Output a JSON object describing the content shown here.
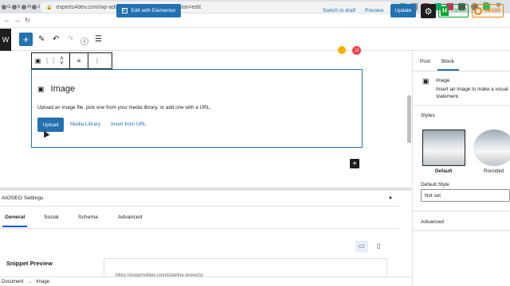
{
  "browser": {
    "tabs": [
      "G",
      "S",
      "Pi",
      "Je",
      "(1",
      "G",
      "ec",
      "G",
      "Ja",
      "",
      "W",
      "S",
      "(1",
      "(1",
      "(1",
      "W",
      "(1",
      "Pi",
      "S",
      "kt",
      "Ki",
      "G",
      "G",
      "W",
      "(1",
      "(1",
      "(1",
      "S",
      "Le",
      "G",
      "ch",
      "S",
      "Je"
    ],
    "active_tab_index": 15,
    "new_tab": "+",
    "url": "experts4dev.com/wp-admin/post.php?post=49&action=edit"
  },
  "toolbar": {
    "wp_logo": "W",
    "inserter": "+",
    "edit_elementor": "Edit with Elementor",
    "switch_draft": "Switch to draft",
    "preview": "Preview",
    "update": "Update",
    "settings": "⚙",
    "aioseo_icon": "H",
    "aioseo_score": "73/100",
    "truseo_score": "58/100"
  },
  "block_toolbar": {
    "type_icon": "image-icon",
    "drag": "⋮⋮",
    "move_up": "˄",
    "move_down": "˅",
    "align": "≡",
    "more": "⋮"
  },
  "placeholder": {
    "title": "Image",
    "instructions": "Upload an image file, pick one from your media library, or add one with a URL.",
    "upload": "Upload",
    "media_library": "Media Library",
    "insert_url": "Insert from URL"
  },
  "appender": "+",
  "notification_count": "12",
  "aioseo_panel": {
    "title": "AIOSEO Settings",
    "caret": "▲",
    "tabs": [
      "General",
      "Social",
      "Schema",
      "Advanced"
    ],
    "active_tab": 0,
    "snippet_title": "Snippet Preview",
    "snippet_url": "https://experts4dev.com/pipeline-projects/"
  },
  "statusbar": {
    "root": "Document",
    "arrow": "→",
    "current": "Image"
  },
  "sidebar": {
    "tabs": [
      "Post",
      "Block"
    ],
    "active_tab": 1,
    "block_name": "Image",
    "block_desc": "Insert an image to make a visual statement.",
    "styles_heading": "Styles",
    "style_default": "Default",
    "style_rounded": "Rounded",
    "default_style_label": "Default Style",
    "default_style_value": "Not set",
    "advanced": "Advanced"
  },
  "colors": {
    "accent": "#2271b1",
    "aioseo_green": "#00a32a",
    "score_orange": "#f18500"
  }
}
